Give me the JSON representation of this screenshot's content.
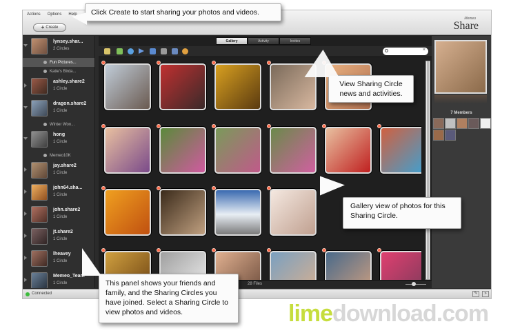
{
  "menu": {
    "items": [
      "Actions",
      "Options",
      "Help"
    ]
  },
  "toolbar": {
    "create_label": "Create"
  },
  "logo": {
    "small": "Memeo",
    "name": "Share"
  },
  "tabs": [
    {
      "label": "Gallery",
      "active": true
    },
    {
      "label": "Activity",
      "active": false
    },
    {
      "label": "Invites",
      "active": false
    }
  ],
  "sidebar": {
    "friends": [
      {
        "name": "lynsey.shar...",
        "sub": "2 Circles",
        "open": true,
        "color": "#a07a5a"
      },
      {
        "name": "ashley.share2",
        "sub": "1 Circle",
        "open": false,
        "color": "#7a4a3a"
      },
      {
        "name": "dragon.share2",
        "sub": "1 Circle",
        "open": true,
        "color": "#5a6a7a"
      },
      {
        "name": "hong",
        "sub": "1 Circle",
        "open": true,
        "color": "#6a6a6a"
      },
      {
        "name": "jay.share2",
        "sub": "1 Circle",
        "open": false,
        "color": "#8a7060"
      },
      {
        "name": "john64.sha...",
        "sub": "1 Circle",
        "open": false,
        "color": "#d08040"
      },
      {
        "name": "john.share2",
        "sub": "1 Circle",
        "open": false,
        "color": "#7a5040"
      },
      {
        "name": "jt.share2",
        "sub": "1 Circle",
        "open": false,
        "color": "#5a4a4a"
      },
      {
        "name": "lheavey",
        "sub": "1 Circle",
        "open": false,
        "color": "#6a5048"
      },
      {
        "name": "Memeo_Team",
        "sub": "1 Circle",
        "open": false,
        "color": "#4a5a6a"
      }
    ],
    "circles": {
      "lynsey_1": "Fun Pictures...",
      "lynsey_2": "Katie's Birda...",
      "dragon": "Winter Won...",
      "hong": "Memeo10K"
    }
  },
  "gallery": {
    "file_count": "28 Files"
  },
  "right_panel": {
    "members_label": "7 Members"
  },
  "status": {
    "text": "Connected"
  },
  "callouts": {
    "create": "Click Create to start sharing your photos and videos.",
    "activity": "View Sharing Circle news and activities.",
    "gallery": "Gallery view of photos for this Sharing Circle.",
    "panel": "This panel shows your friends and family, and the Sharing Circles you have joined. Select a Sharing Circle to view photos and videos."
  },
  "watermark": {
    "lime": "lime",
    "rest": "download.com"
  },
  "colors": {
    "accent_star": "#ff6a4a",
    "status_green": "#3cbc3c",
    "watermark_lime": "#c6dd3d"
  }
}
